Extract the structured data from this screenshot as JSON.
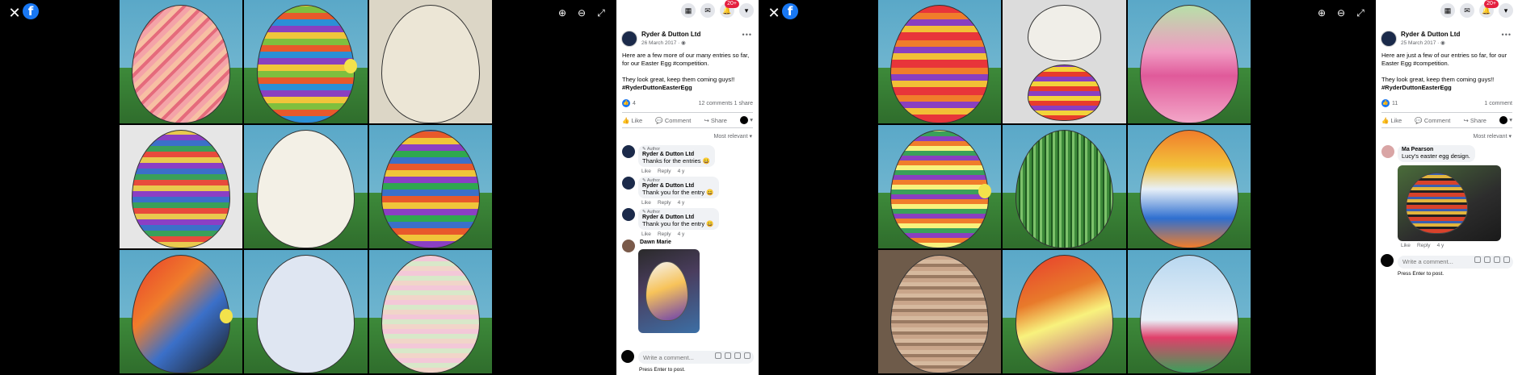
{
  "viewer_common": {
    "close_icon": "close-icon",
    "facebook_logo_letter": "f",
    "zoom_in_glyph": "⊕",
    "zoom_out_glyph": "⊖",
    "fullscreen_glyph": "⤢",
    "topbar": {
      "menu_glyph": "▦",
      "messenger_glyph": "✉",
      "notifications_glyph": "🔔",
      "notifications_badge": "20+",
      "account_glyph": "▾"
    },
    "press_enter_hint": "Press Enter to post.",
    "write_placeholder": "Write a comment...",
    "like_label": "Like",
    "comment_label": "Comment",
    "share_label": "Share",
    "reply_label": "Reply",
    "author_tag": "Author",
    "sort_label": "Most relevant",
    "more_glyph": "•••"
  },
  "left_post": {
    "page_name": "Ryder & Dutton Ltd",
    "date": "26 March 2017 · ",
    "text_line1": "Here are a few more of our many entries so far, for our Easter Egg #competition.",
    "text_line2": "They look great, keep them coming guys!!",
    "hashtag": "#RyderDuttonEasterEgg",
    "reaction_count": "4",
    "comments_count": "12 comments",
    "shares_count": "1 share",
    "comments": [
      {
        "author": "Ryder & Dutton Ltd",
        "text": "Thanks for the entries 😀",
        "time": "4 y"
      },
      {
        "author": "Ryder & Dutton Ltd",
        "text": "Thank you for the entry 😀",
        "time": "4 y"
      },
      {
        "author": "Ryder & Dutton Ltd",
        "text": "Thank you for the entry 😀",
        "time": "4 y"
      }
    ],
    "photo_commenter": "Dawn Marie"
  },
  "right_post": {
    "page_name": "Ryder & Dutton Ltd",
    "date": "25 March 2017 · ",
    "text_line1": "Here are just a few of our entries so far, for our Easter Egg #competition.",
    "text_line2": "They look great, keep them coming guys!!",
    "hashtag": "#RyderDuttonEasterEgg",
    "reaction_count": "11",
    "comments_count": "1 comment",
    "comment": {
      "author": "Ma Pearson",
      "text": "Lucy's easter egg design.",
      "time": "4 y"
    }
  },
  "colors": {
    "facebook_blue": "#1877f2",
    "badge_red": "#e41e3f",
    "left_tiles": [
      "#f4a3a8",
      "#2b8fd6",
      "#e8e2d0",
      "#e9c94e",
      "#f3f0e6",
      "#8b3fc4",
      "#e83b2c",
      "#dfe6f2",
      "#f1d5c9"
    ],
    "right_tiles": [
      "#e8353a",
      "#f0eee8",
      "#f09ac2",
      "#f8f27d",
      "#3d8a3a",
      "#f07d2b",
      "#c9a58a",
      "#e87a2b",
      "#b9d8f0"
    ]
  }
}
